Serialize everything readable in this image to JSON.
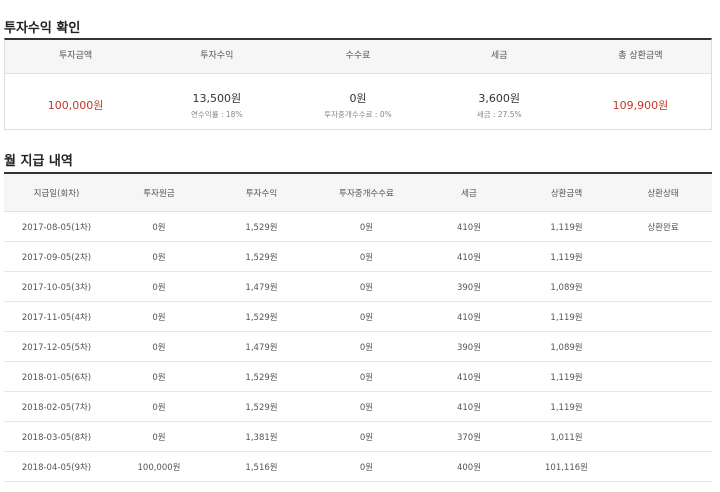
{
  "summary": {
    "title": "투자수익 확인",
    "headers": [
      "투자금액",
      "투자수익",
      "수수료",
      "세금",
      "총 상환금액"
    ],
    "investment": "100,000원",
    "profit": "13,500원",
    "profit_sub": "연수익률 : 18%",
    "fee": "0원",
    "fee_sub": "투자중개수수료 : 0%",
    "tax": "3,600원",
    "tax_sub": "세금 : 27.5%",
    "total": "109,900원"
  },
  "monthly": {
    "title": "월 지급 내역",
    "headers": [
      "지급일(회차)",
      "투자원금",
      "투자수익",
      "투자중개수수료",
      "세금",
      "상환금액",
      "상환상태"
    ],
    "rows": [
      [
        "2017-08-05(1차)",
        "0원",
        "1,529원",
        "0원",
        "410원",
        "1,119원",
        "상환완료"
      ],
      [
        "2017-09-05(2차)",
        "0원",
        "1,529원",
        "0원",
        "410원",
        "1,119원",
        ""
      ],
      [
        "2017-10-05(3차)",
        "0원",
        "1,479원",
        "0원",
        "390원",
        "1,089원",
        ""
      ],
      [
        "2017-11-05(4차)",
        "0원",
        "1,529원",
        "0원",
        "410원",
        "1,119원",
        ""
      ],
      [
        "2017-12-05(5차)",
        "0원",
        "1,479원",
        "0원",
        "390원",
        "1,089원",
        ""
      ],
      [
        "2018-01-05(6차)",
        "0원",
        "1,529원",
        "0원",
        "410원",
        "1,119원",
        ""
      ],
      [
        "2018-02-05(7차)",
        "0원",
        "1,529원",
        "0원",
        "410원",
        "1,119원",
        ""
      ],
      [
        "2018-03-05(8차)",
        "0원",
        "1,381원",
        "0원",
        "370원",
        "1,011원",
        ""
      ],
      [
        "2018-04-05(9차)",
        "100,000원",
        "1,516원",
        "0원",
        "400원",
        "101,116원",
        ""
      ]
    ]
  },
  "colors": {
    "accent_red": "#c0392b",
    "header_bg": "#f6f6f6",
    "border_dark": "#333333"
  }
}
